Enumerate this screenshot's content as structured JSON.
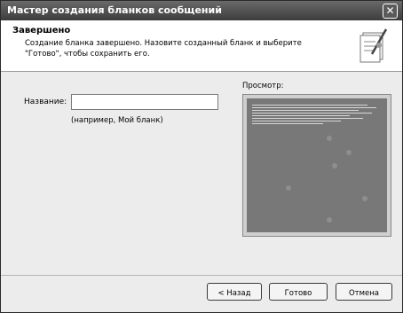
{
  "window": {
    "title": "Мастер создания бланков сообщений",
    "close_glyph": "✕"
  },
  "header": {
    "title": "Завершено",
    "line1": "Создание бланка завершено. Назовите созданный бланк и выберите",
    "line2": "\"Готово\", чтобы сохранить его."
  },
  "form": {
    "name_label": "Название:",
    "name_value": "",
    "example": "(например, Мой бланк)"
  },
  "preview": {
    "label": "Просмотр:"
  },
  "buttons": {
    "back": "< Назад",
    "finish": "Готово",
    "cancel": "Отмена"
  }
}
